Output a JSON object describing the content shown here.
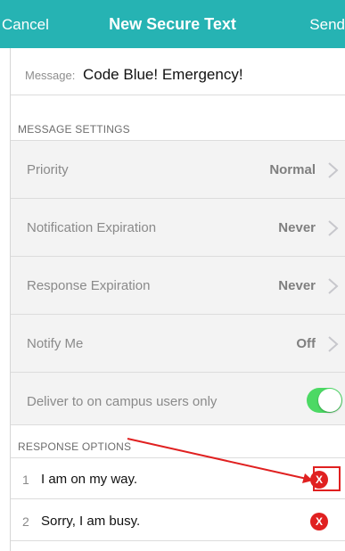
{
  "navbar": {
    "cancel_label": "Cancel",
    "title": "New Secure Text",
    "send_label": "Send",
    "background_color": "#26b3b3"
  },
  "message": {
    "label": "Message:",
    "value": "Code Blue! Emergency!"
  },
  "message_settings": {
    "header": "MESSAGE SETTINGS",
    "rows": [
      {
        "label": "Priority",
        "value": "Normal",
        "icon": "chevron-right-icon"
      },
      {
        "label": "Notification Expiration",
        "value": "Never",
        "icon": "chevron-right-icon"
      },
      {
        "label": "Response Expiration",
        "value": "Never",
        "icon": "chevron-right-icon"
      },
      {
        "label": "Notify Me",
        "value": "Off",
        "icon": "chevron-right-icon"
      },
      {
        "label": "Deliver to on campus users only",
        "toggle_on": true,
        "toggle_color": "#4cd964"
      }
    ]
  },
  "response_options": {
    "header": "RESPONSE OPTIONS",
    "items": [
      {
        "number": "1",
        "text": "I am on my way.",
        "delete_icon": "x-circle-icon",
        "highlighted": true
      },
      {
        "number": "2",
        "text": "Sorry, I am busy.",
        "delete_icon": "x-circle-icon",
        "highlighted": false
      }
    ],
    "delete_glyph": "X",
    "delete_color": "#e02020"
  },
  "annotation": {
    "arrow_color": "#e02020",
    "arrow_icon": "arrow-annotation-icon"
  }
}
